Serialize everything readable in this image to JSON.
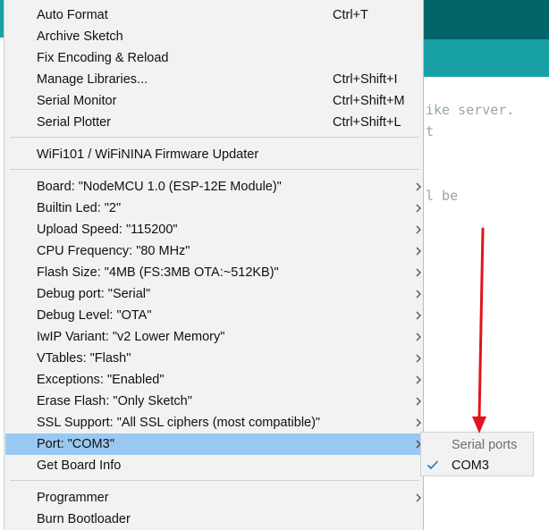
{
  "background": {
    "code_lines": [
      "ike server.",
      "t",
      "l be"
    ],
    "colors": {
      "header_dark": "#006468",
      "header_teal": "#17a1a5"
    }
  },
  "menu": {
    "items": [
      {
        "label": "Auto Format",
        "shortcut": "Ctrl+T"
      },
      {
        "label": "Archive Sketch",
        "shortcut": ""
      },
      {
        "label": "Fix Encoding & Reload",
        "shortcut": ""
      },
      {
        "label": "Manage Libraries...",
        "shortcut": "Ctrl+Shift+I"
      },
      {
        "label": "Serial Monitor",
        "shortcut": "Ctrl+Shift+M"
      },
      {
        "label": "Serial Plotter",
        "shortcut": "Ctrl+Shift+L"
      },
      {
        "label": "WiFi101 / WiFiNINA Firmware Updater",
        "shortcut": ""
      },
      {
        "label": "Board: \"NodeMCU 1.0 (ESP-12E Module)\"",
        "submenu": true
      },
      {
        "label": "Builtin Led: \"2\"",
        "submenu": true
      },
      {
        "label": "Upload Speed: \"115200\"",
        "submenu": true
      },
      {
        "label": "CPU Frequency: \"80 MHz\"",
        "submenu": true
      },
      {
        "label": "Flash Size: \"4MB (FS:3MB OTA:~512KB)\"",
        "submenu": true
      },
      {
        "label": "Debug port: \"Serial\"",
        "submenu": true
      },
      {
        "label": "Debug Level: \"OTA\"",
        "submenu": true
      },
      {
        "label": "IwIP Variant: \"v2 Lower Memory\"",
        "submenu": true
      },
      {
        "label": "VTables: \"Flash\"",
        "submenu": true
      },
      {
        "label": "Exceptions: \"Enabled\"",
        "submenu": true
      },
      {
        "label": "Erase Flash: \"Only Sketch\"",
        "submenu": true
      },
      {
        "label": "SSL Support: \"All SSL ciphers (most compatible)\"",
        "submenu": true
      },
      {
        "label": "Port: \"COM3\"",
        "submenu": true,
        "highlighted": true
      },
      {
        "label": "Get Board Info",
        "shortcut": ""
      },
      {
        "label": "Programmer",
        "submenu": true
      },
      {
        "label": "Burn Bootloader",
        "shortcut": ""
      }
    ],
    "highlight_color": "#99c9f2"
  },
  "port_submenu": {
    "header": "Serial ports",
    "items": [
      {
        "label": "COM3",
        "checked": true
      }
    ]
  },
  "annotation": {
    "color": "#e0141e",
    "icon": "red-arrow-pointing-down"
  }
}
